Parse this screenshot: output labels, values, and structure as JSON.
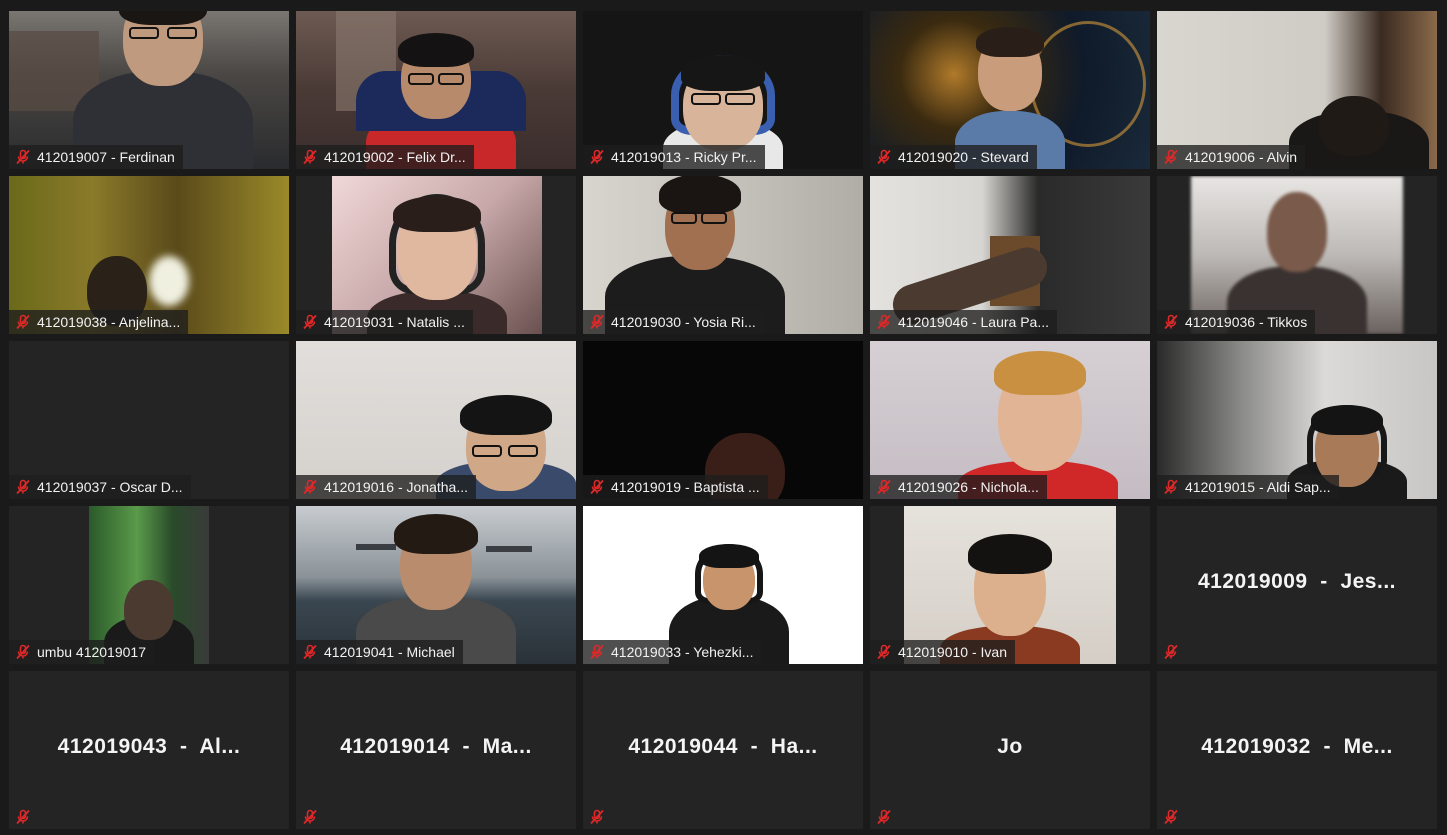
{
  "meeting": {
    "view": "gallery",
    "participants": [
      {
        "label": "412019007 - Ferdinan",
        "muted": true
      },
      {
        "label": "412019002 - Felix Dr...",
        "muted": true
      },
      {
        "label": "412019013 - Ricky Pr...",
        "muted": true
      },
      {
        "label": "412019020 - Stevard",
        "muted": true
      },
      {
        "label": "412019006 - Alvin",
        "muted": true
      },
      {
        "label": "412019038 - Anjelina...",
        "muted": true
      },
      {
        "label": "412019031 - Natalis ...",
        "muted": true
      },
      {
        "label": "412019030 - Yosia Ri...",
        "muted": true
      },
      {
        "label": "412019046 - Laura Pa...",
        "muted": true
      },
      {
        "label": "412019036 - Tikkos",
        "muted": true
      },
      {
        "label": "412019037 - Oscar D...",
        "muted": true
      },
      {
        "label": "412019016 - Jonatha...",
        "muted": true
      },
      {
        "label": "412019019 - Baptista ...",
        "muted": true
      },
      {
        "label": "412019026 - Nichola...",
        "muted": true
      },
      {
        "label": "412019015 - Aldi Sap...",
        "muted": true
      },
      {
        "label": "umbu 412019017",
        "muted": true
      },
      {
        "label": "412019041 - Michael",
        "muted": true
      },
      {
        "label": "412019033 - Yehezki...",
        "muted": true
      },
      {
        "label": "412019010 - Ivan",
        "muted": true
      },
      {
        "label": "412019009  -  Jes...",
        "muted": true,
        "video": false
      },
      {
        "label": "412019043  -  Al...",
        "muted": true,
        "video": false
      },
      {
        "label": "412019014  -  Ma...",
        "muted": true,
        "video": false
      },
      {
        "label": "412019044  -  Ha...",
        "muted": true,
        "video": false
      },
      {
        "label": "Jo",
        "muted": true,
        "video": false
      },
      {
        "label": "412019032  -  Me...",
        "muted": true,
        "video": false
      }
    ]
  },
  "icons": {
    "muted_mic": "mic-off-icon"
  },
  "colors": {
    "background": "#1a1a1a",
    "tile_empty": "#242424",
    "muted_icon": "#e02828",
    "label_text": "#f2f2f2"
  }
}
